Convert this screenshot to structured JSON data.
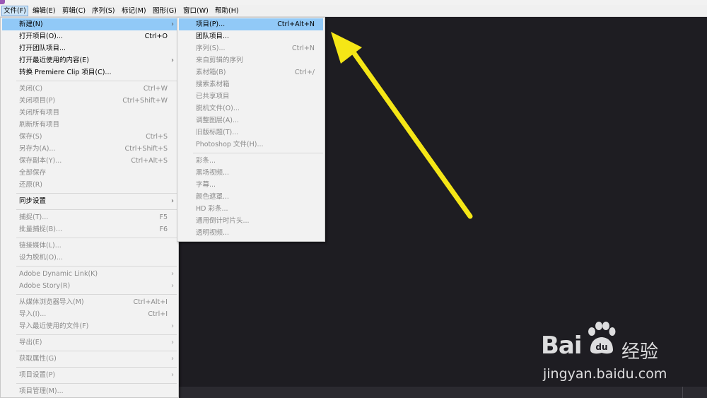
{
  "menubar": {
    "items": [
      "文件(F)",
      "编辑(E)",
      "剪辑(C)",
      "序列(S)",
      "标记(M)",
      "图形(G)",
      "窗口(W)",
      "帮助(H)"
    ]
  },
  "file_menu": {
    "items": [
      {
        "label": "新建(N)",
        "shortcut": "",
        "submenu": true,
        "enabled": true,
        "highlighted": true
      },
      {
        "label": "打开项目(O)...",
        "shortcut": "Ctrl+O",
        "enabled": true
      },
      {
        "label": "打开团队项目...",
        "shortcut": "",
        "enabled": true
      },
      {
        "label": "打开最近使用的内容(E)",
        "shortcut": "",
        "submenu": true,
        "enabled": true
      },
      {
        "label": "转换 Premiere Clip 项目(C)...",
        "shortcut": "",
        "enabled": true
      },
      {
        "label": "关闭(C)",
        "shortcut": "Ctrl+W",
        "enabled": false
      },
      {
        "label": "关闭项目(P)",
        "shortcut": "Ctrl+Shift+W",
        "enabled": false
      },
      {
        "label": "关闭所有项目",
        "shortcut": "",
        "enabled": false
      },
      {
        "label": "刷新所有项目",
        "shortcut": "",
        "enabled": false
      },
      {
        "label": "保存(S)",
        "shortcut": "Ctrl+S",
        "enabled": false
      },
      {
        "label": "另存为(A)...",
        "shortcut": "Ctrl+Shift+S",
        "enabled": false
      },
      {
        "label": "保存副本(Y)...",
        "shortcut": "Ctrl+Alt+S",
        "enabled": false
      },
      {
        "label": "全部保存",
        "shortcut": "",
        "enabled": false
      },
      {
        "label": "还原(R)",
        "shortcut": "",
        "enabled": false
      },
      {
        "label": "同步设置",
        "shortcut": "",
        "submenu": true,
        "enabled": true
      },
      {
        "label": "捕捉(T)...",
        "shortcut": "F5",
        "enabled": false
      },
      {
        "label": "批量捕捉(B)...",
        "shortcut": "F6",
        "enabled": false
      },
      {
        "label": "链接媒体(L)...",
        "shortcut": "",
        "enabled": false
      },
      {
        "label": "设为脱机(O)...",
        "shortcut": "",
        "enabled": false
      },
      {
        "label": "Adobe Dynamic Link(K)",
        "shortcut": "",
        "submenu": true,
        "enabled": false
      },
      {
        "label": "Adobe Story(R)",
        "shortcut": "",
        "submenu": true,
        "enabled": false
      },
      {
        "label": "从媒体浏览器导入(M)",
        "shortcut": "Ctrl+Alt+I",
        "enabled": false
      },
      {
        "label": "导入(I)...",
        "shortcut": "Ctrl+I",
        "enabled": false
      },
      {
        "label": "导入最近使用的文件(F)",
        "shortcut": "",
        "submenu": true,
        "enabled": false
      },
      {
        "label": "导出(E)",
        "shortcut": "",
        "submenu": true,
        "enabled": false
      },
      {
        "label": "获取属性(G)",
        "shortcut": "",
        "submenu": true,
        "enabled": false
      },
      {
        "label": "项目设置(P)",
        "shortcut": "",
        "submenu": true,
        "enabled": false
      },
      {
        "label": "项目管理(M)...",
        "shortcut": "",
        "enabled": false
      }
    ]
  },
  "new_submenu": {
    "items": [
      {
        "label": "项目(P)...",
        "shortcut": "Ctrl+Alt+N",
        "enabled": true,
        "highlighted": true
      },
      {
        "label": "团队项目...",
        "shortcut": "",
        "enabled": true
      },
      {
        "label": "序列(S)...",
        "shortcut": "Ctrl+N",
        "enabled": false
      },
      {
        "label": "来自剪辑的序列",
        "shortcut": "",
        "enabled": false
      },
      {
        "label": "素材箱(B)",
        "shortcut": "Ctrl+/",
        "enabled": false
      },
      {
        "label": "搜索素材箱",
        "shortcut": "",
        "enabled": false
      },
      {
        "label": "已共享项目",
        "shortcut": "",
        "enabled": false
      },
      {
        "label": "脱机文件(O)...",
        "shortcut": "",
        "enabled": false
      },
      {
        "label": "调整图层(A)...",
        "shortcut": "",
        "enabled": false
      },
      {
        "label": "旧版标题(T)...",
        "shortcut": "",
        "enabled": false
      },
      {
        "label": "Photoshop 文件(H)...",
        "shortcut": "",
        "enabled": false
      },
      {
        "label": "彩条...",
        "shortcut": "",
        "enabled": false
      },
      {
        "label": "黑场视频...",
        "shortcut": "",
        "enabled": false
      },
      {
        "label": "字幕...",
        "shortcut": "",
        "enabled": false
      },
      {
        "label": "颜色遮罩...",
        "shortcut": "",
        "enabled": false
      },
      {
        "label": "HD 彩条...",
        "shortcut": "",
        "enabled": false
      },
      {
        "label": "通用倒计时片头...",
        "shortcut": "",
        "enabled": false
      },
      {
        "label": "透明视频...",
        "shortcut": "",
        "enabled": false
      }
    ]
  },
  "watermark": {
    "brand": "Bai",
    "brand2": "经验",
    "url": "jingyan.baidu.com"
  },
  "colors": {
    "highlight": "#91c9f7",
    "arrow": "#f5e616",
    "canvas": "#1e1d22"
  }
}
